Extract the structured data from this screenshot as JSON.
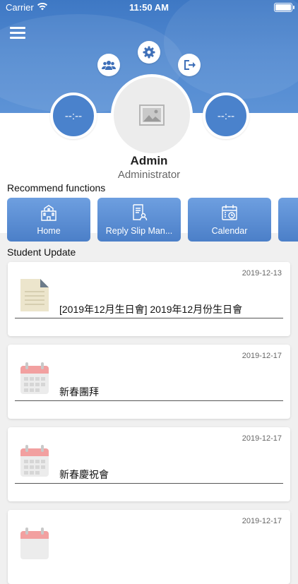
{
  "status": {
    "carrier": "Carrier",
    "time": "11:50 AM"
  },
  "profile": {
    "left_value": "--:--",
    "right_value": "--:--",
    "name": "Admin",
    "role": "Administrator"
  },
  "recommend": {
    "title": "Recommend functions",
    "items": [
      {
        "label": "Home",
        "icon": "school-building-icon"
      },
      {
        "label": "Reply Slip Man...",
        "icon": "reply-slip-icon"
      },
      {
        "label": "Calendar",
        "icon": "calendar-clock-icon"
      },
      {
        "label": "",
        "icon": ""
      }
    ]
  },
  "updates": {
    "title": "Student Update",
    "items": [
      {
        "date": "2019-12-13",
        "title": "[2019年12月生日會] 2019年12月份生日會",
        "icon": "document-icon"
      },
      {
        "date": "2019-12-17",
        "title": "新春團拜",
        "icon": "calendar-icon"
      },
      {
        "date": "2019-12-17",
        "title": "新春慶祝會",
        "icon": "calendar-icon"
      },
      {
        "date": "2019-12-17",
        "title": "",
        "icon": "calendar-icon"
      }
    ]
  },
  "colors": {
    "accent": "#4a82cc",
    "header": "#3e78c4",
    "calendar_top": "#f06b6b"
  }
}
